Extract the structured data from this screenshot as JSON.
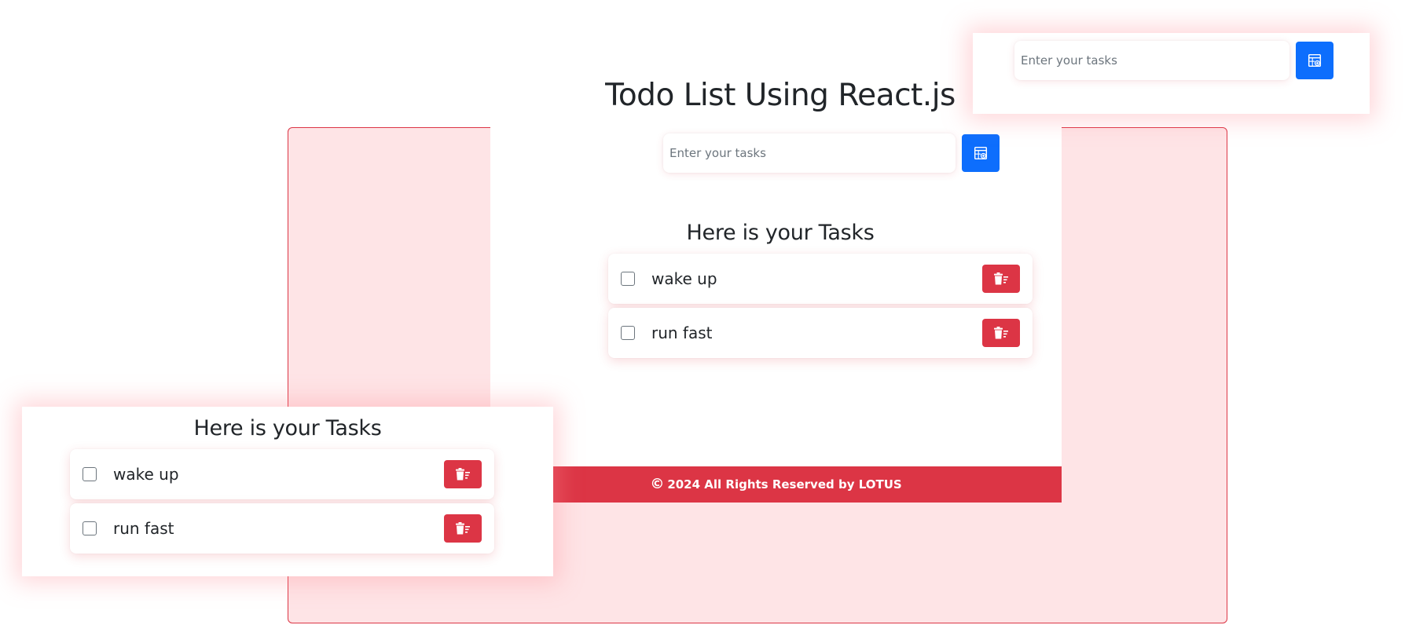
{
  "app": {
    "title": "Todo List Using React.js",
    "input_placeholder": "Enter your tasks",
    "tasks_heading": "Here is your Tasks",
    "tasks": [
      {
        "label": "wake up",
        "checked": false
      },
      {
        "label": "run fast",
        "checked": false
      }
    ],
    "footer": {
      "copyright_symbol": "©",
      "text": "2024 All Rights Reserved by LOTUS"
    }
  },
  "popup_top": {
    "input_placeholder": "Enter your tasks"
  },
  "popup_left": {
    "tasks_heading": "Here is your Tasks",
    "tasks": [
      {
        "label": "wake up",
        "checked": false
      },
      {
        "label": "run fast",
        "checked": false
      }
    ]
  },
  "icons": {
    "add": "calendar-add-icon",
    "delete": "trash-icon"
  },
  "colors": {
    "primary": "#0d6efd",
    "danger": "#dc3545",
    "backdrop": "#fee4e6",
    "text": "#212529"
  }
}
